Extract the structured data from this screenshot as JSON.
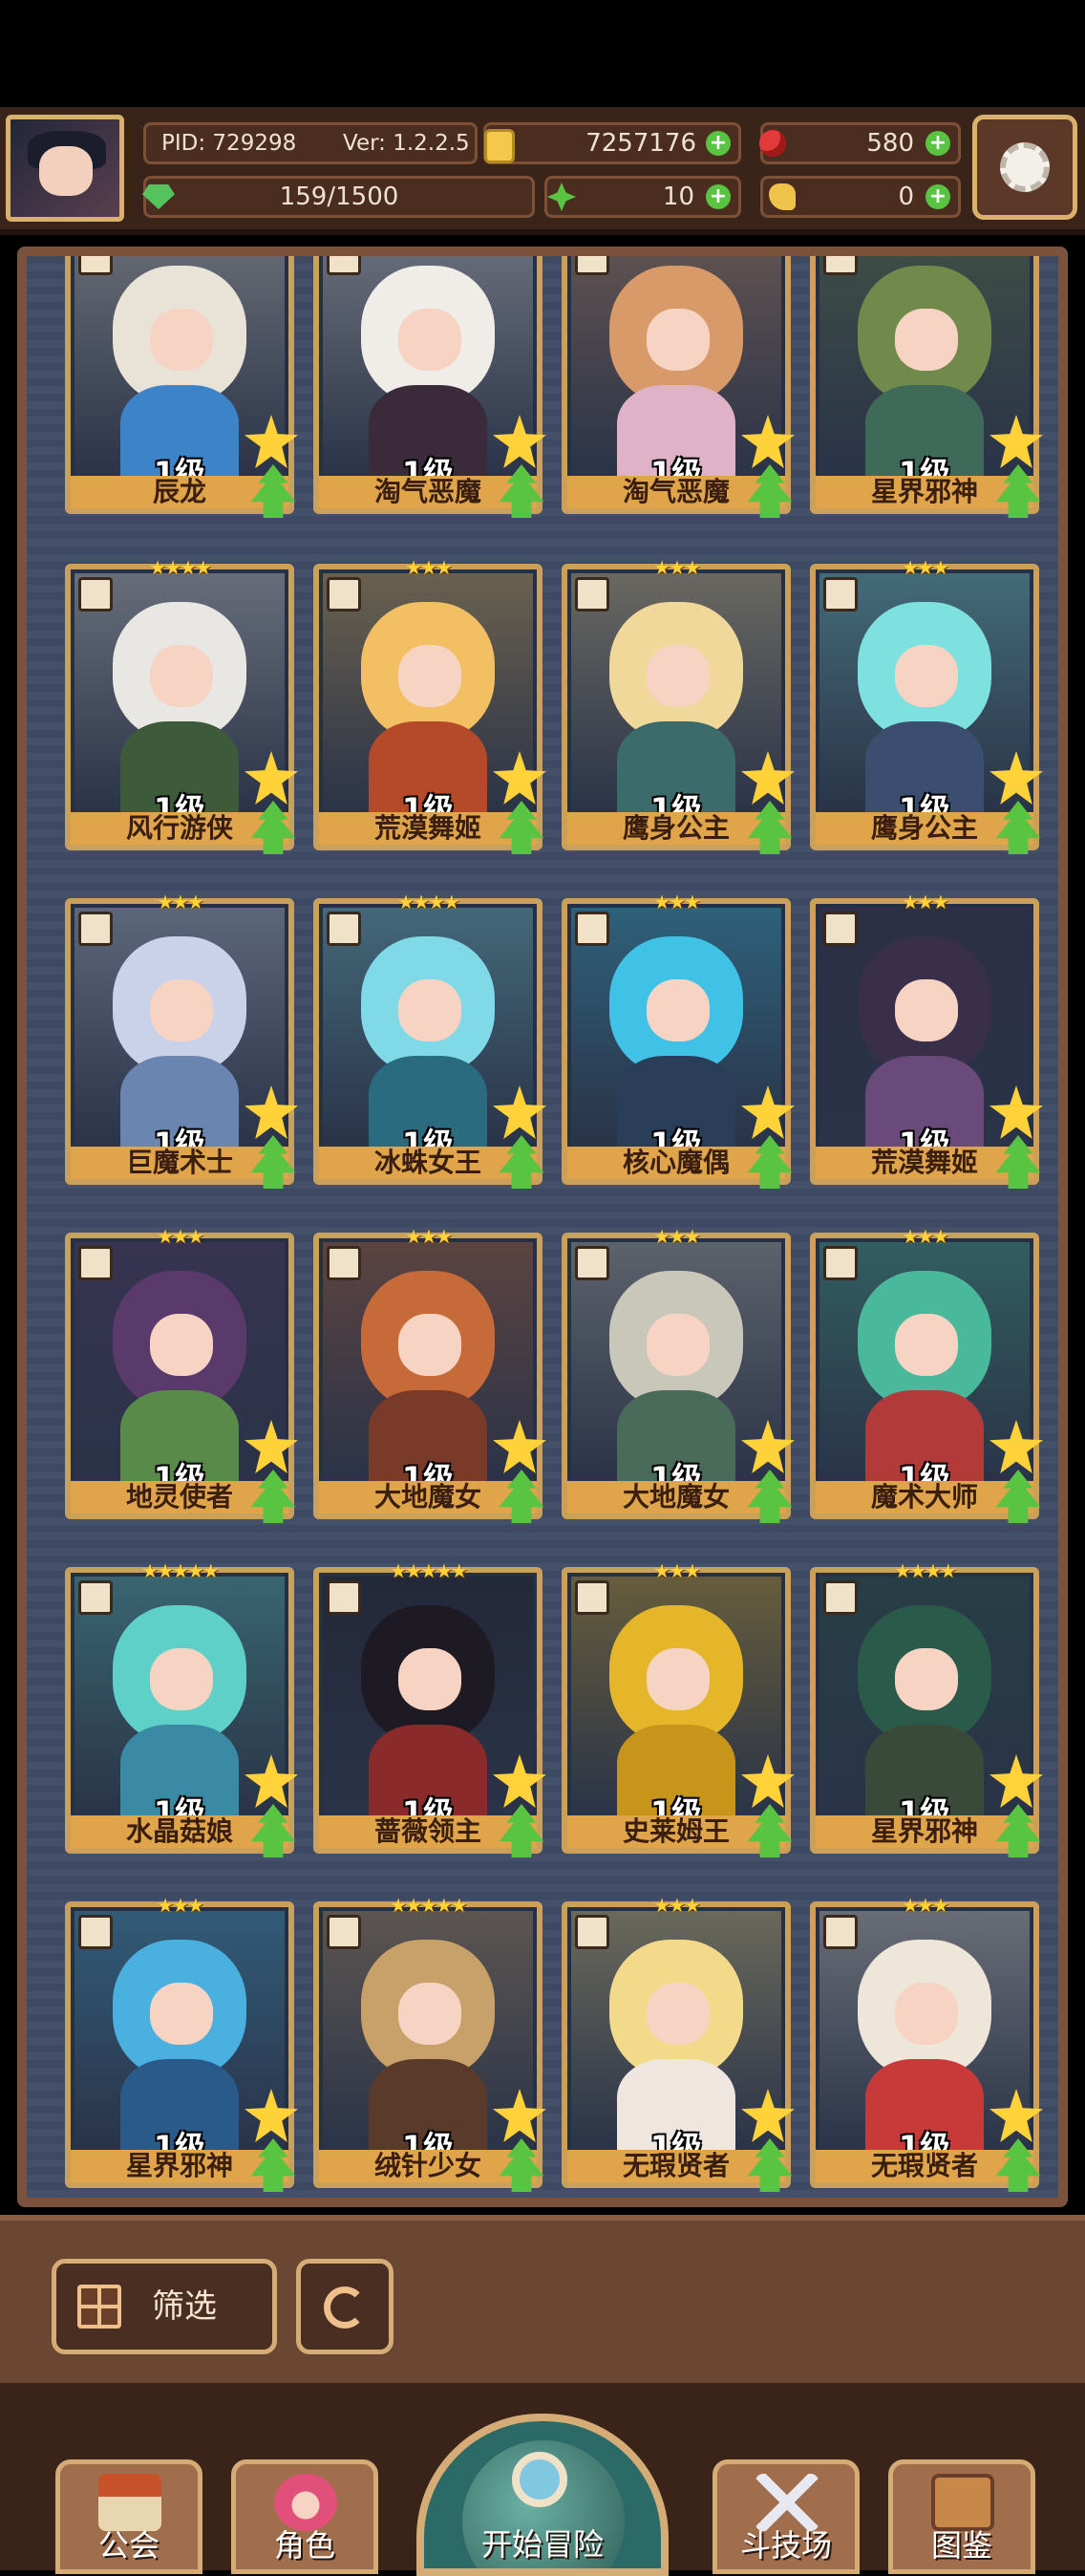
{
  "player": {
    "pid": "PID: 729298",
    "version": "Ver: 1.2.2.5",
    "gold": "7257176",
    "ruby": "580",
    "stamina": "159/1500",
    "clover": "10",
    "hands": "0"
  },
  "cards": [
    {
      "level": "1级",
      "name": "辰龙",
      "stars": "",
      "hair": "#e9e2d6",
      "body": "#3d83c7"
    },
    {
      "level": "1级",
      "name": "淘气恶魔",
      "stars": "",
      "hair": "#f0ece8",
      "body": "#3a2a3a"
    },
    {
      "level": "1级",
      "name": "淘气恶魔",
      "stars": "",
      "hair": "#d99a6a",
      "body": "#e0b2c8"
    },
    {
      "level": "1级",
      "name": "星界邪神",
      "stars": "",
      "hair": "#6f8a4a",
      "body": "#3f6a5a"
    },
    {
      "level": "1级",
      "name": "风行游侠",
      "stars": "★★★★",
      "hair": "#e9e7e4",
      "body": "#3d5b3a"
    },
    {
      "level": "1级",
      "name": "荒漠舞姬",
      "stars": "★★★",
      "hair": "#f2c063",
      "body": "#b54a2a"
    },
    {
      "level": "1级",
      "name": "鹰身公主",
      "stars": "★★★",
      "hair": "#f0d79a",
      "body": "#3b6b6a"
    },
    {
      "level": "1级",
      "name": "鹰身公主",
      "stars": "★★★",
      "hair": "#7fe0e0",
      "body": "#3b4e70"
    },
    {
      "level": "1级",
      "name": "巨魔术士",
      "stars": "★★★",
      "hair": "#c9d2e8",
      "body": "#6a86b0"
    },
    {
      "level": "1级",
      "name": "冰蛛女王",
      "stars": "★★★★",
      "hair": "#7fd9e6",
      "body": "#2a6b80"
    },
    {
      "level": "1级",
      "name": "核心魔偶",
      "stars": "★★★",
      "hair": "#3fc2e6",
      "body": "#2a3e5a"
    },
    {
      "level": "1级",
      "name": "荒漠舞姬",
      "stars": "★★★",
      "hair": "#3a2f4a",
      "body": "#6a4a7a"
    },
    {
      "level": "1级",
      "name": "地灵使者",
      "stars": "★★★",
      "hair": "#5a3a6a",
      "body": "#5a8a4a"
    },
    {
      "level": "1级",
      "name": "大地魔女",
      "stars": "★★★",
      "hair": "#c66a3a",
      "body": "#7a3a2a"
    },
    {
      "level": "1级",
      "name": "大地魔女",
      "stars": "★★★",
      "hair": "#c9c7b9",
      "body": "#4a6a5a"
    },
    {
      "level": "1级",
      "name": "魔术大师",
      "stars": "★★★",
      "hair": "#4ab89a",
      "body": "#b33a3a"
    },
    {
      "level": "1级",
      "name": "水晶菇娘",
      "stars": "★★★★★",
      "hair": "#5fd0c8",
      "body": "#3a8aa6"
    },
    {
      "level": "1级",
      "name": "蔷薇领主",
      "stars": "★★★★★",
      "hair": "#1e1a24",
      "body": "#8a2a2a"
    },
    {
      "level": "1级",
      "name": "史莱姆王",
      "stars": "★★★",
      "hair": "#e6b62a",
      "body": "#c7951a"
    },
    {
      "level": "1级",
      "name": "星界邪神",
      "stars": "★★★★",
      "hair": "#2a5a4a",
      "body": "#3a4a3a"
    },
    {
      "level": "1级",
      "name": "星界邪神",
      "stars": "★★★",
      "hair": "#4ab0e0",
      "body": "#2a5a8a"
    },
    {
      "level": "1级",
      "name": "绒针少女",
      "stars": "★★★★★",
      "hair": "#c8a06a",
      "body": "#5a3a2a"
    },
    {
      "level": "1级",
      "name": "无瑕贤者",
      "stars": "★★★",
      "hair": "#f2da8a",
      "body": "#f0e6e0"
    },
    {
      "level": "1级",
      "name": "无瑕贤者",
      "stars": "★★★",
      "hair": "#efe6da",
      "body": "#c83a3a"
    }
  ],
  "controls": {
    "filter_label": "筛选"
  },
  "nav": {
    "guild": "公会",
    "character": "角色",
    "adventure": "开始冒险",
    "arena": "斗技场",
    "codex": "图鉴"
  }
}
